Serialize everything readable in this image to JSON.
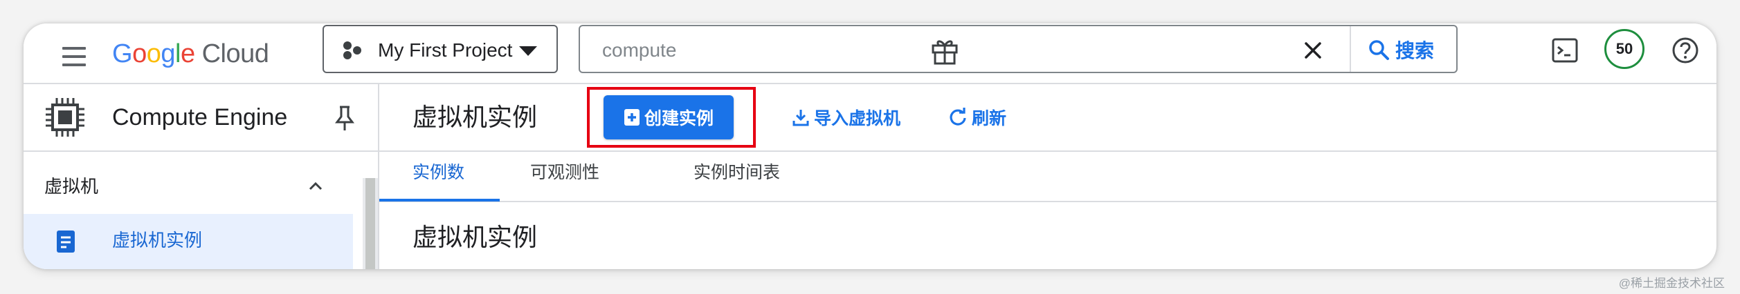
{
  "header": {
    "logo": {
      "google": [
        {
          "ch": "G",
          "color": "#4285F4"
        },
        {
          "ch": "o",
          "color": "#EA4335"
        },
        {
          "ch": "o",
          "color": "#FBBC05"
        },
        {
          "ch": "g",
          "color": "#4285F4"
        },
        {
          "ch": "l",
          "color": "#34A853"
        },
        {
          "ch": "e",
          "color": "#EA4335"
        }
      ],
      "cloud": "Cloud"
    },
    "project": {
      "label": "My First Project"
    },
    "search": {
      "value": "compute",
      "button_label": "搜索"
    },
    "badge_count": "50",
    "icons": [
      "menu-icon",
      "gift-icon",
      "terminal-icon",
      "help-icon"
    ]
  },
  "sidebar": {
    "title": "Compute Engine",
    "section_label": "虚拟机",
    "active_item_label": "虚拟机实例"
  },
  "main": {
    "page_title": "虚拟机实例",
    "create_button": "创建实例",
    "import_link": "导入虚拟机",
    "refresh_link": "刷新",
    "tabs": [
      {
        "label": "实例数",
        "active": true
      },
      {
        "label": "可观测性",
        "active": false
      },
      {
        "label": "实例时间表",
        "active": false
      }
    ],
    "section_title": "虚拟机实例"
  },
  "colors": {
    "accent": "#1a73e8",
    "highlight": "#e60012",
    "badge_ring": "#1e8e3e"
  },
  "watermark": "@稀土掘金技术社区"
}
